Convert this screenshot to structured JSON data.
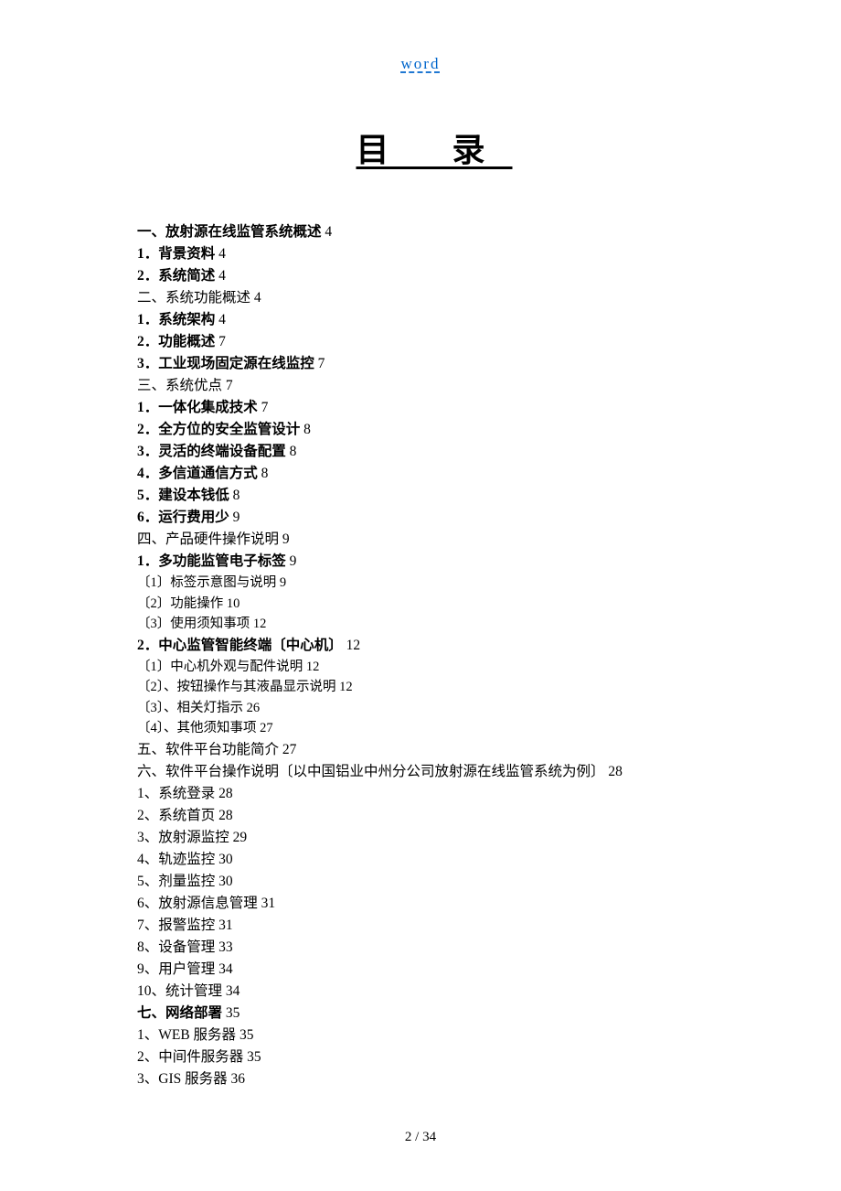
{
  "header": {
    "link_text": "word"
  },
  "title": "目 录",
  "toc": [
    {
      "bold": true,
      "sub": false,
      "text": "一、放射源在线监管系统概述",
      "page": "4"
    },
    {
      "bold": true,
      "sub": false,
      "text": "1．背景资料",
      "page": "4"
    },
    {
      "bold": true,
      "sub": false,
      "text": "2．系统简述",
      "page": "4"
    },
    {
      "bold": false,
      "sub": false,
      "text": "二、系统功能概述",
      "page": "4"
    },
    {
      "bold": true,
      "sub": false,
      "text": "1．系统架构",
      "page": "4"
    },
    {
      "bold": true,
      "sub": false,
      "text": "2．功能概述",
      "page": "7"
    },
    {
      "bold": true,
      "sub": false,
      "text": "3．工业现场固定源在线监控",
      "page": "7"
    },
    {
      "bold": false,
      "sub": false,
      "text": "三、系统优点",
      "page": "7"
    },
    {
      "bold": true,
      "sub": false,
      "text": "1．一体化集成技术",
      "page": "7"
    },
    {
      "bold": true,
      "sub": false,
      "text": "2．全方位的安全监管设计",
      "page": "8"
    },
    {
      "bold": true,
      "sub": false,
      "text": "3．灵活的终端设备配置",
      "page": "8"
    },
    {
      "bold": true,
      "sub": false,
      "text": "4．多信道通信方式",
      "page": "8"
    },
    {
      "bold": true,
      "sub": false,
      "text": "5．建设本钱低",
      "page": "8"
    },
    {
      "bold": true,
      "sub": false,
      "text": "6．运行费用少",
      "page": "9"
    },
    {
      "bold": false,
      "sub": false,
      "text": "四、产品硬件操作说明",
      "page": "9"
    },
    {
      "bold": true,
      "sub": false,
      "text": "1．多功能监管电子标签",
      "page": "9"
    },
    {
      "bold": false,
      "sub": true,
      "text": "〔1〕标签示意图与说明",
      "page": "9"
    },
    {
      "bold": false,
      "sub": true,
      "text": "〔2〕功能操作",
      "page": "10"
    },
    {
      "bold": false,
      "sub": true,
      "text": "〔3〕使用须知事项",
      "page": "12"
    },
    {
      "bold": true,
      "sub": false,
      "text": "2．中心监管智能终端〔中心机〕",
      "page": "12"
    },
    {
      "bold": false,
      "sub": true,
      "text": "〔1〕中心机外观与配件说明",
      "page": "12"
    },
    {
      "bold": false,
      "sub": true,
      "text": "〔2〕、按钮操作与其液晶显示说明",
      "page": "12"
    },
    {
      "bold": false,
      "sub": true,
      "text": "〔3〕、相关灯指示",
      "page": "26"
    },
    {
      "bold": false,
      "sub": true,
      "text": "〔4〕、其他须知事项",
      "page": "27"
    },
    {
      "bold": false,
      "sub": false,
      "text": "五、软件平台功能简介",
      "page": "27"
    },
    {
      "bold": false,
      "sub": false,
      "text": "六、软件平台操作说明〔以中国铝业中州分公司放射源在线监管系统为例〕",
      "page": "28"
    },
    {
      "bold": false,
      "sub": false,
      "text": "1、系统登录",
      "page": "28"
    },
    {
      "bold": false,
      "sub": false,
      "text": "2、系统首页",
      "page": "28"
    },
    {
      "bold": false,
      "sub": false,
      "text": "3、放射源监控",
      "page": "29"
    },
    {
      "bold": false,
      "sub": false,
      "text": "4、轨迹监控",
      "page": "30"
    },
    {
      "bold": false,
      "sub": false,
      "text": "5、剂量监控",
      "page": "30"
    },
    {
      "bold": false,
      "sub": false,
      "text": "6、放射源信息管理",
      "page": "31"
    },
    {
      "bold": false,
      "sub": false,
      "text": "7、报警监控",
      "page": "31"
    },
    {
      "bold": false,
      "sub": false,
      "text": "8、设备管理",
      "page": "33"
    },
    {
      "bold": false,
      "sub": false,
      "text": "9、用户管理",
      "page": "34"
    },
    {
      "bold": false,
      "sub": false,
      "text": "10、统计管理",
      "page": "34"
    },
    {
      "bold": true,
      "sub": false,
      "text": "七、网络部署",
      "page": "35"
    },
    {
      "bold": false,
      "sub": false,
      "text": "1、WEB 服务器",
      "page": "35"
    },
    {
      "bold": false,
      "sub": false,
      "text": "2、中间件服务器",
      "page": "35"
    },
    {
      "bold": false,
      "sub": false,
      "text": "3、GIS 服务器",
      "page": "36"
    }
  ],
  "footer": {
    "text": "2  / 34"
  }
}
